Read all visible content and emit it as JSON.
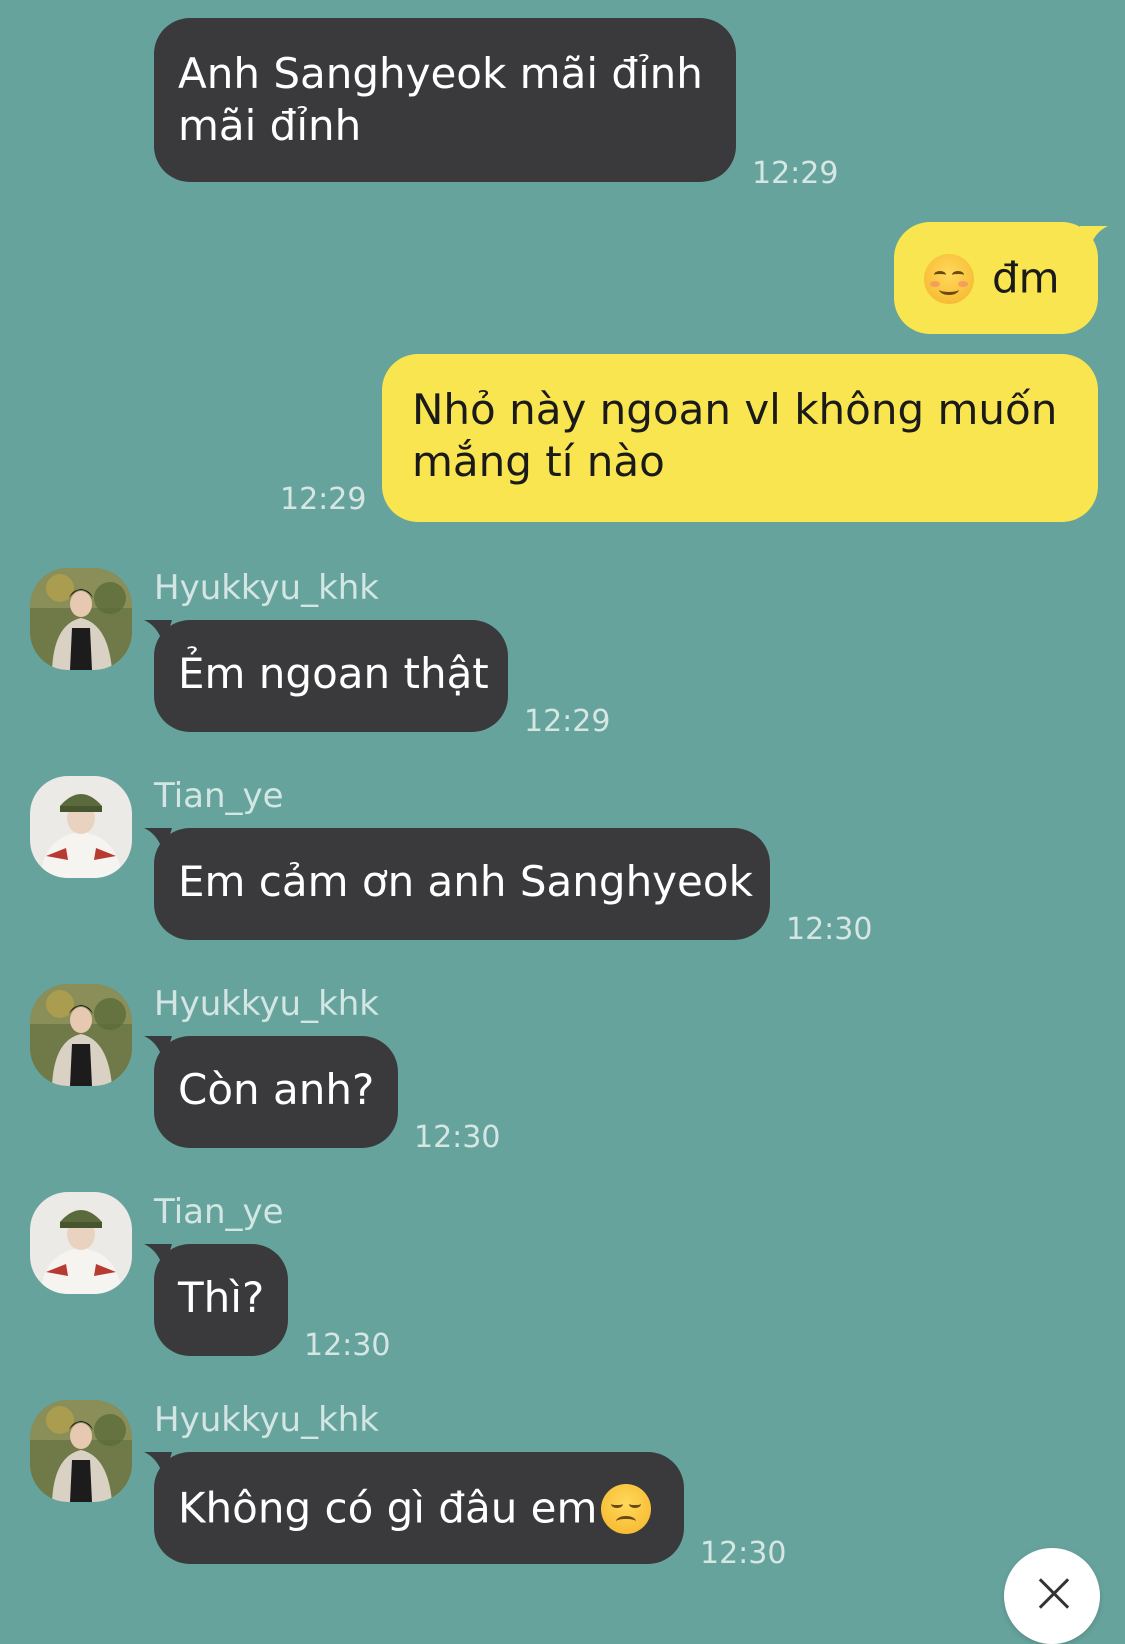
{
  "messages": [
    {
      "sender": "",
      "text": "Anh Sanghyeok mãi đỉnh\nmãi đỉnh",
      "time": "12:29"
    },
    {
      "sender": "me",
      "text": "đm",
      "time": ""
    },
    {
      "sender": "me",
      "text": "Nhỏ này ngoan vl không muốn\nmắng tí nào",
      "time": "12:29"
    },
    {
      "sender": "Hyukkyu_khk",
      "text": "Ẻm ngoan thật",
      "time": "12:29"
    },
    {
      "sender": "Tian_ye",
      "text": "Em cảm ơn anh Sanghyeok",
      "time": "12:30"
    },
    {
      "sender": "Hyukkyu_khk",
      "text": "Còn anh?",
      "time": "12:30"
    },
    {
      "sender": "Tian_ye",
      "text": "Thì?",
      "time": "12:30"
    },
    {
      "sender": "Hyukkyu_khk",
      "text": "Không có gì đâu em",
      "time": "12:30"
    }
  ],
  "colors": {
    "background": "#67a39d",
    "incoming_bubble": "#3a3a3c",
    "outgoing_bubble": "#f9e54f"
  },
  "icons": {
    "emoji_outgoing": "smiling-face-icon",
    "emoji_last": "disappointed-face-icon",
    "close": "close-icon"
  }
}
